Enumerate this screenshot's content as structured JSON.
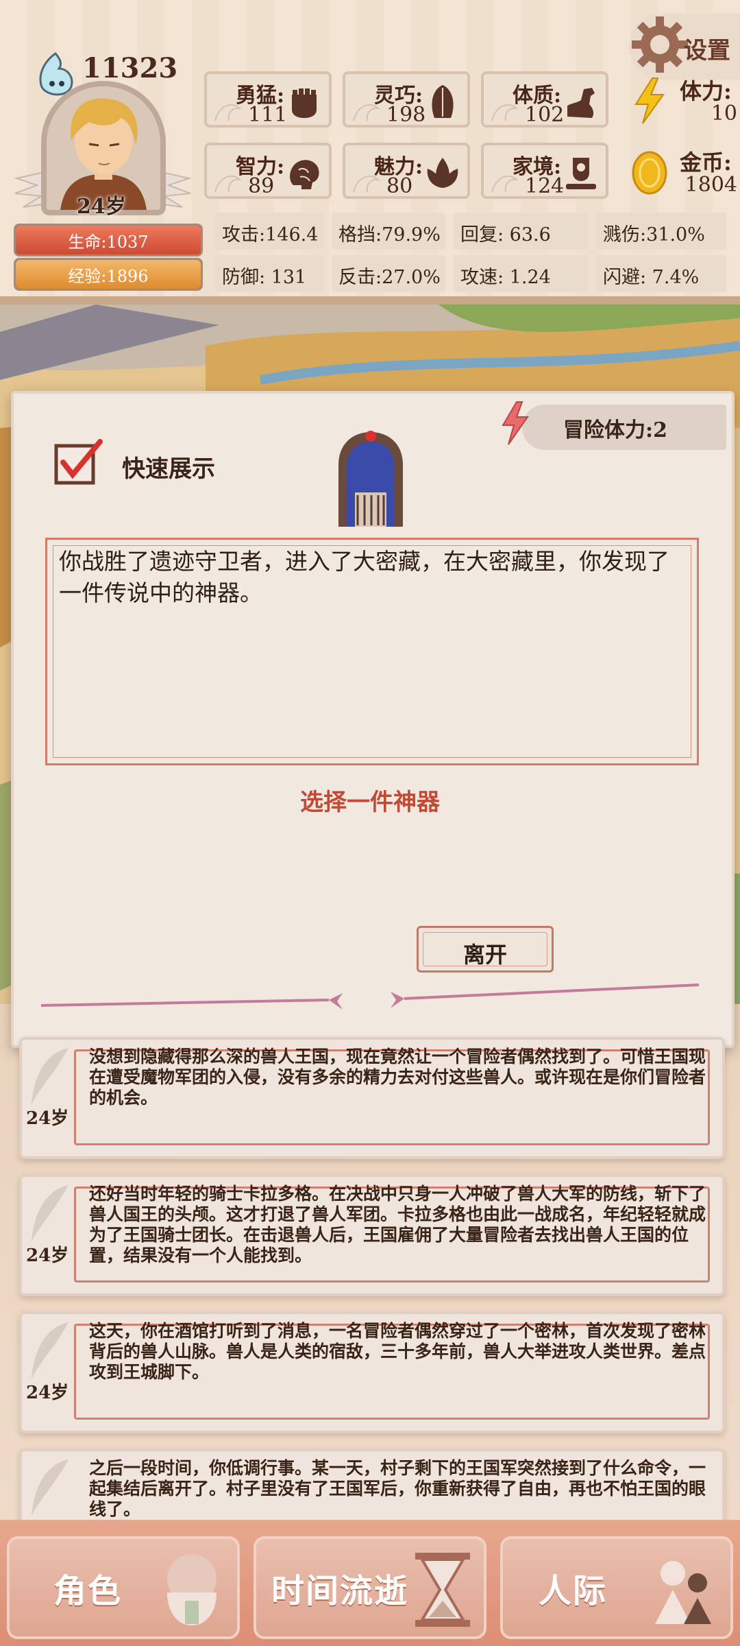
{
  "header": {
    "settings_label": "设置",
    "soul_count": "11323",
    "age": "24岁",
    "hp": {
      "label": "生命:1037",
      "fraction": 1.0
    },
    "exp": {
      "label": "经验:1896",
      "fraction": 1.0
    },
    "attributes": [
      {
        "name": "勇猛:",
        "value": "111",
        "icon": "fist-icon"
      },
      {
        "name": "灵巧:",
        "value": "198",
        "icon": "leaf-hand-icon"
      },
      {
        "name": "体质:",
        "value": "102",
        "icon": "muscle-arm-icon"
      },
      {
        "name": "智力:",
        "value": "89",
        "icon": "brain-icon"
      },
      {
        "name": "魅力:",
        "value": "80",
        "icon": "lotus-icon"
      },
      {
        "name": "家境:",
        "value": "124",
        "icon": "home-heart-icon"
      }
    ],
    "stamina": {
      "name": "体力:",
      "value": "10",
      "icon": "lightning-icon"
    },
    "gold": {
      "name": "金币:",
      "value": "1804",
      "icon": "gold-coin-icon"
    },
    "combat_stats": [
      "攻击:146.4",
      "格挡:79.9%",
      "回复:  63.6",
      "溅伤:31.0%",
      "防御:  131",
      "反击:27.0%",
      "攻速:  1.24",
      "闪避:  7.4%"
    ]
  },
  "event": {
    "adventure_stamina": "冒险体力:2",
    "quick_show_label": "快速展示",
    "quick_show_checked": true,
    "text": "你战胜了遗迹守卫者，进入了大密藏，在大密藏里，你发现了一件传说中的神器。",
    "prompt": "选择一件神器",
    "leave_label": "离开"
  },
  "log": [
    {
      "age": "24岁",
      "text": "没想到隐藏得那么深的兽人王国，现在竟然让一个冒险者偶然找到了。可惜王国现在遭受魔物军团的入侵，没有多余的精力去对付这些兽人。或许现在是你们冒险者的机会。"
    },
    {
      "age": "24岁",
      "text": "还好当时年轻的骑士卡拉多格。在决战中只身一人冲破了兽人大军的防线，斩下了兽人国王的头颅。这才打退了兽人军团。卡拉多格也由此一战成名，年纪轻轻就成为了王国骑士团长。在击退兽人后，王国雇佣了大量冒险者去找出兽人王国的位置，结果没有一个人能找到。"
    },
    {
      "age": "24岁",
      "text": "这天，你在酒馆打听到了消息，一名冒险者偶然穿过了一个密林，首次发现了密林背后的兽人山脉。兽人是人类的宿敌，三十多年前，兽人大举进攻人类世界。差点攻到王城脚下。"
    },
    {
      "age": "24岁",
      "text": "之后一段时间，你低调行事。某一天，村子剩下的王国军突然接到了什么命令，一起集结后离开了。村子里没有了王国军后，你重新获得了自由，再也不怕王国的眼线了。"
    }
  ],
  "nav": {
    "character": "角色",
    "time": "时间流逝",
    "social": "人际"
  }
}
